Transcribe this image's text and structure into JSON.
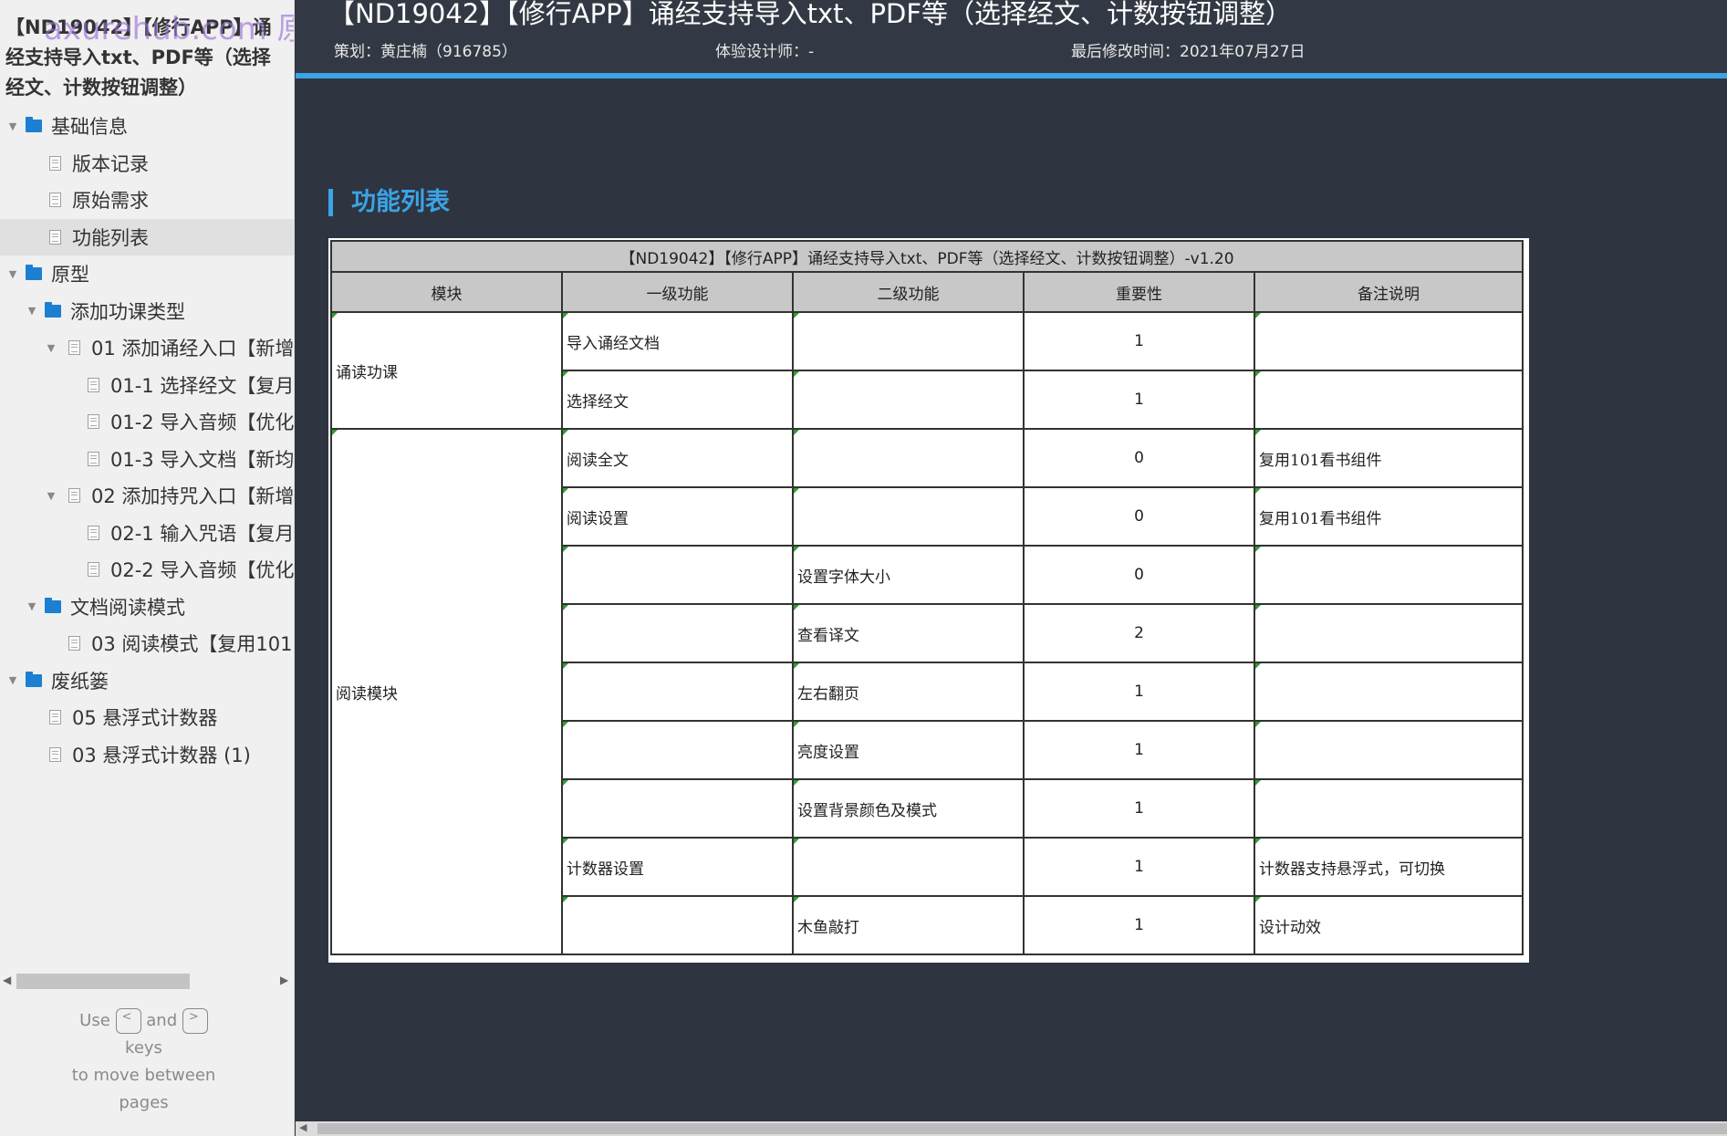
{
  "doc": {
    "title": "【ND19042】【修行APP】诵经支持导入txt、PDF等（选择经文、计数按钮调整）",
    "watermark": "axurehub.com 原型资源站"
  },
  "tree": [
    {
      "type": "folder",
      "label": "基础信息",
      "caret": "▼"
    },
    {
      "type": "page",
      "label": "版本记录"
    },
    {
      "type": "page",
      "label": "原始需求"
    },
    {
      "type": "page",
      "label": "功能列表",
      "selected": true
    },
    {
      "type": "folder",
      "label": "原型",
      "caret": "▼"
    },
    {
      "type": "folder",
      "label": "添加功课类型",
      "caret": "▼"
    },
    {
      "type": "page",
      "label": "01 添加诵经入口【新增",
      "caret": "▼"
    },
    {
      "type": "page",
      "label": "01-1 选择经文【复月"
    },
    {
      "type": "page",
      "label": "01-2 导入音频【优化"
    },
    {
      "type": "page",
      "label": "01-3 导入文档【新均"
    },
    {
      "type": "page",
      "label": "02 添加持咒入口【新增",
      "caret": "▼"
    },
    {
      "type": "page",
      "label": "02-1 输入咒语【复月"
    },
    {
      "type": "page",
      "label": "02-2 导入音频【优化"
    },
    {
      "type": "folder",
      "label": "文档阅读模式",
      "caret": "▼"
    },
    {
      "type": "page",
      "label": "03 阅读模式【复用101"
    },
    {
      "type": "folder",
      "label": "废纸篓",
      "caret": "▼"
    },
    {
      "type": "page",
      "label": "05 悬浮式计数器"
    },
    {
      "type": "page",
      "label": "03 悬浮式计数器 (1)"
    }
  ],
  "scroll": {
    "left_arrow": "◀",
    "right_arrow": "▶"
  },
  "help": {
    "use": "Use",
    "key_prev": "<",
    "and": "and",
    "key_next": ">",
    "keys": "keys",
    "line2": "to move between",
    "line3": "pages"
  },
  "header": {
    "title": "【ND19042】【修行APP】诵经支持导入txt、PDF等（选择经文、计数按钮调整）",
    "planner": "策划：黄庄楠（916785）",
    "designer": "体验设计师：-",
    "modified": "最后修改时间：2021年07月27日"
  },
  "section": {
    "title": "功能列表"
  },
  "table": {
    "caption": "【ND19042】【修行APP】诵经支持导入txt、PDF等（选择经文、计数按钮调整）-v1.20",
    "columns": [
      "模块",
      "一级功能",
      "二级功能",
      "重要性",
      "备注说明"
    ],
    "groups": [
      {
        "module": "诵读功课",
        "rows": [
          {
            "level1": "导入诵经文档",
            "level2": "",
            "importance": "1",
            "note": ""
          },
          {
            "level1": "选择经文",
            "level2": "",
            "importance": "1",
            "note": ""
          }
        ]
      },
      {
        "module": "阅读模块",
        "rows": [
          {
            "level1": "阅读全文",
            "level2": "",
            "importance": "0",
            "note": "复用101看书组件"
          },
          {
            "level1": "阅读设置",
            "level2": "",
            "importance": "0",
            "note": "复用101看书组件"
          },
          {
            "level1": "",
            "level2": "设置字体大小",
            "importance": "0",
            "note": ""
          },
          {
            "level1": "",
            "level2": "查看译文",
            "importance": "2",
            "note": ""
          },
          {
            "level1": "",
            "level2": "左右翻页",
            "importance": "1",
            "note": ""
          },
          {
            "level1": "",
            "level2": "亮度设置",
            "importance": "1",
            "note": ""
          },
          {
            "level1": "",
            "level2": "设置背景颜色及模式",
            "importance": "1",
            "note": ""
          },
          {
            "level1": "计数器设置",
            "level2": "",
            "importance": "1",
            "note": "计数器支持悬浮式，可切换"
          },
          {
            "level1": "",
            "level2": "木鱼敲打",
            "importance": "1",
            "note": "设计动效"
          }
        ]
      }
    ]
  },
  "colors": {
    "accent": "#3aa4e6",
    "folder": "#1c7fd2",
    "background": "#2f3441"
  }
}
